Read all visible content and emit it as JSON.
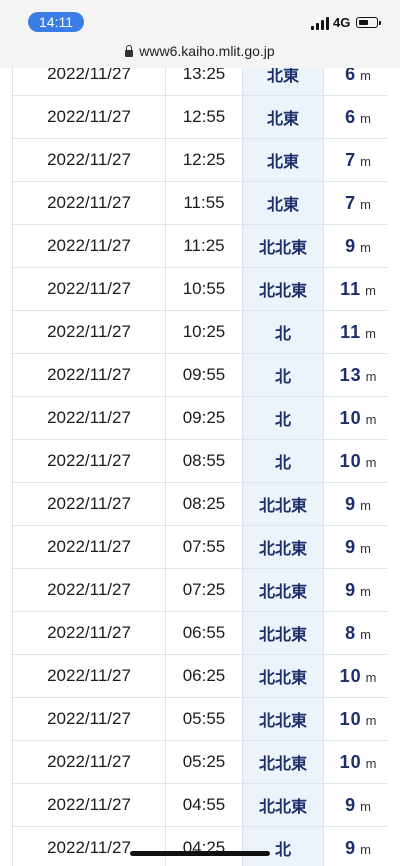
{
  "status_bar": {
    "time": "14:11",
    "network": "4G"
  },
  "browser": {
    "url": "www6.kaiho.mlit.go.jp"
  },
  "table": {
    "rows": [
      {
        "date": "2022/11/27",
        "time": "13:25",
        "direction": "北東",
        "height": "6",
        "unit": "m"
      },
      {
        "date": "2022/11/27",
        "time": "12:55",
        "direction": "北東",
        "height": "6",
        "unit": "m"
      },
      {
        "date": "2022/11/27",
        "time": "12:25",
        "direction": "北東",
        "height": "7",
        "unit": "m"
      },
      {
        "date": "2022/11/27",
        "time": "11:55",
        "direction": "北東",
        "height": "7",
        "unit": "m"
      },
      {
        "date": "2022/11/27",
        "time": "11:25",
        "direction": "北北東",
        "height": "9",
        "unit": "m"
      },
      {
        "date": "2022/11/27",
        "time": "10:55",
        "direction": "北北東",
        "height": "11",
        "unit": "m"
      },
      {
        "date": "2022/11/27",
        "time": "10:25",
        "direction": "北",
        "height": "11",
        "unit": "m"
      },
      {
        "date": "2022/11/27",
        "time": "09:55",
        "direction": "北",
        "height": "13",
        "unit": "m"
      },
      {
        "date": "2022/11/27",
        "time": "09:25",
        "direction": "北",
        "height": "10",
        "unit": "m"
      },
      {
        "date": "2022/11/27",
        "time": "08:55",
        "direction": "北",
        "height": "10",
        "unit": "m"
      },
      {
        "date": "2022/11/27",
        "time": "08:25",
        "direction": "北北東",
        "height": "9",
        "unit": "m"
      },
      {
        "date": "2022/11/27",
        "time": "07:55",
        "direction": "北北東",
        "height": "9",
        "unit": "m"
      },
      {
        "date": "2022/11/27",
        "time": "07:25",
        "direction": "北北東",
        "height": "9",
        "unit": "m"
      },
      {
        "date": "2022/11/27",
        "time": "06:55",
        "direction": "北北東",
        "height": "8",
        "unit": "m"
      },
      {
        "date": "2022/11/27",
        "time": "06:25",
        "direction": "北北東",
        "height": "10",
        "unit": "m"
      },
      {
        "date": "2022/11/27",
        "time": "05:55",
        "direction": "北北東",
        "height": "10",
        "unit": "m"
      },
      {
        "date": "2022/11/27",
        "time": "05:25",
        "direction": "北北東",
        "height": "10",
        "unit": "m"
      },
      {
        "date": "2022/11/27",
        "time": "04:55",
        "direction": "北北東",
        "height": "9",
        "unit": "m"
      },
      {
        "date": "2022/11/27",
        "time": "04:25",
        "direction": "北",
        "height": "9",
        "unit": "m"
      }
    ]
  }
}
